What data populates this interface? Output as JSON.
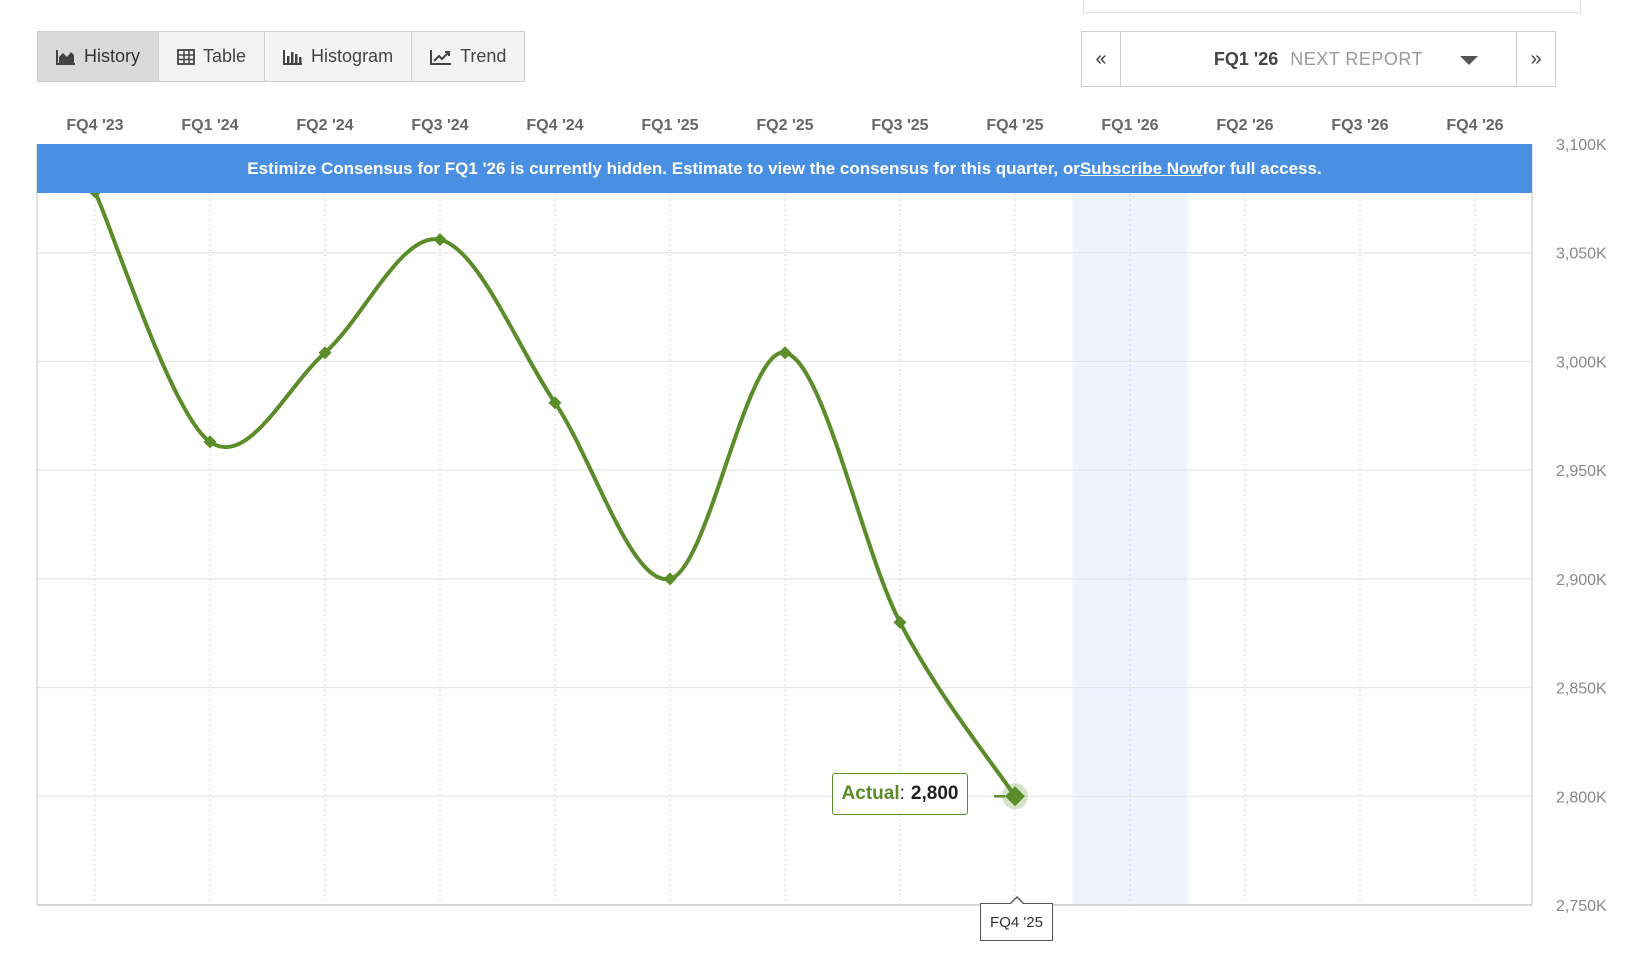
{
  "tabs": [
    {
      "label": "History",
      "icon": "area-chart-icon",
      "active": true
    },
    {
      "label": "Table",
      "icon": "table-icon",
      "active": false
    },
    {
      "label": "Histogram",
      "icon": "histogram-icon",
      "active": false
    },
    {
      "label": "Trend",
      "icon": "trend-icon",
      "active": false
    }
  ],
  "nav": {
    "prev": "«",
    "quarter": "FQ1 '26",
    "next_report": "NEXT REPORT",
    "next": "»"
  },
  "banner": {
    "text_before": "Estimize Consensus for FQ1 '26 is currently hidden. Estimate to view the consensus for this quarter, or ",
    "link": "Subscribe Now",
    "text_after": "for full access."
  },
  "tooltip": {
    "key": "Actual",
    "colon": ": ",
    "value": "2,800",
    "axis_label": "FQ4 '25"
  },
  "colors": {
    "line": "#5b8c2a",
    "banner": "#4a90e2",
    "highlight": "#eef4fd",
    "grid": "#e2e2e2"
  },
  "chart_data": {
    "type": "line",
    "categories": [
      "FQ4 '23",
      "FQ1 '24",
      "FQ2 '24",
      "FQ3 '24",
      "FQ4 '24",
      "FQ1 '25",
      "FQ2 '25",
      "FQ3 '25",
      "FQ4 '25",
      "FQ1 '26",
      "FQ2 '26",
      "FQ3 '26",
      "FQ4 '26"
    ],
    "series": [
      {
        "values": [
          3078,
          2963,
          3004,
          3056,
          2981,
          2900,
          3004,
          2880,
          2800,
          null,
          null,
          null,
          null
        ]
      }
    ],
    "y_ticks": [
      "3,100K",
      "3,050K",
      "3,000K",
      "2,950K",
      "2,900K",
      "2,850K",
      "2,800K",
      "2,750K"
    ],
    "ylim": [
      2750,
      3100
    ],
    "highlight_category": "FQ1 '26",
    "selected_category": "FQ4 '25",
    "grid": true
  }
}
